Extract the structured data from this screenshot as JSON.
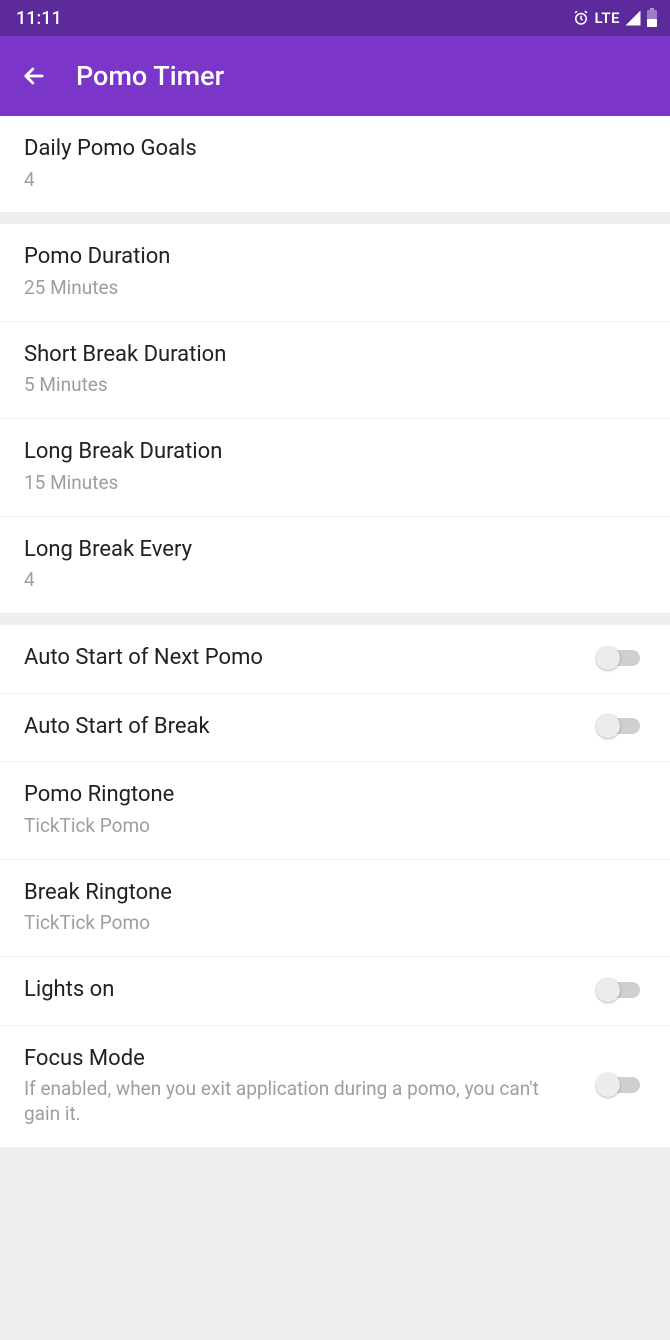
{
  "status": {
    "time": "11:11",
    "lte": "LTE"
  },
  "appbar": {
    "title": "Pomo Timer"
  },
  "section1": {
    "daily_goals": {
      "label": "Daily Pomo Goals",
      "value": "4"
    }
  },
  "section2": {
    "pomo_duration": {
      "label": "Pomo Duration",
      "value": "25 Minutes"
    },
    "short_break": {
      "label": "Short Break Duration",
      "value": "5 Minutes"
    },
    "long_break": {
      "label": "Long Break Duration",
      "value": "15 Minutes"
    },
    "long_break_every": {
      "label": "Long Break Every",
      "value": "4"
    }
  },
  "section3": {
    "auto_next_pomo": {
      "label": "Auto Start of Next Pomo",
      "on": false
    },
    "auto_break": {
      "label": "Auto Start of Break",
      "on": false
    },
    "pomo_ringtone": {
      "label": "Pomo Ringtone",
      "value": "TickTick Pomo"
    },
    "break_ringtone": {
      "label": "Break Ringtone",
      "value": "TickTick Pomo"
    },
    "lights_on": {
      "label": "Lights on",
      "on": false
    },
    "focus_mode": {
      "label": "Focus Mode",
      "desc": "If enabled, when you exit application during a pomo, you can't gain it.",
      "on": false
    }
  }
}
